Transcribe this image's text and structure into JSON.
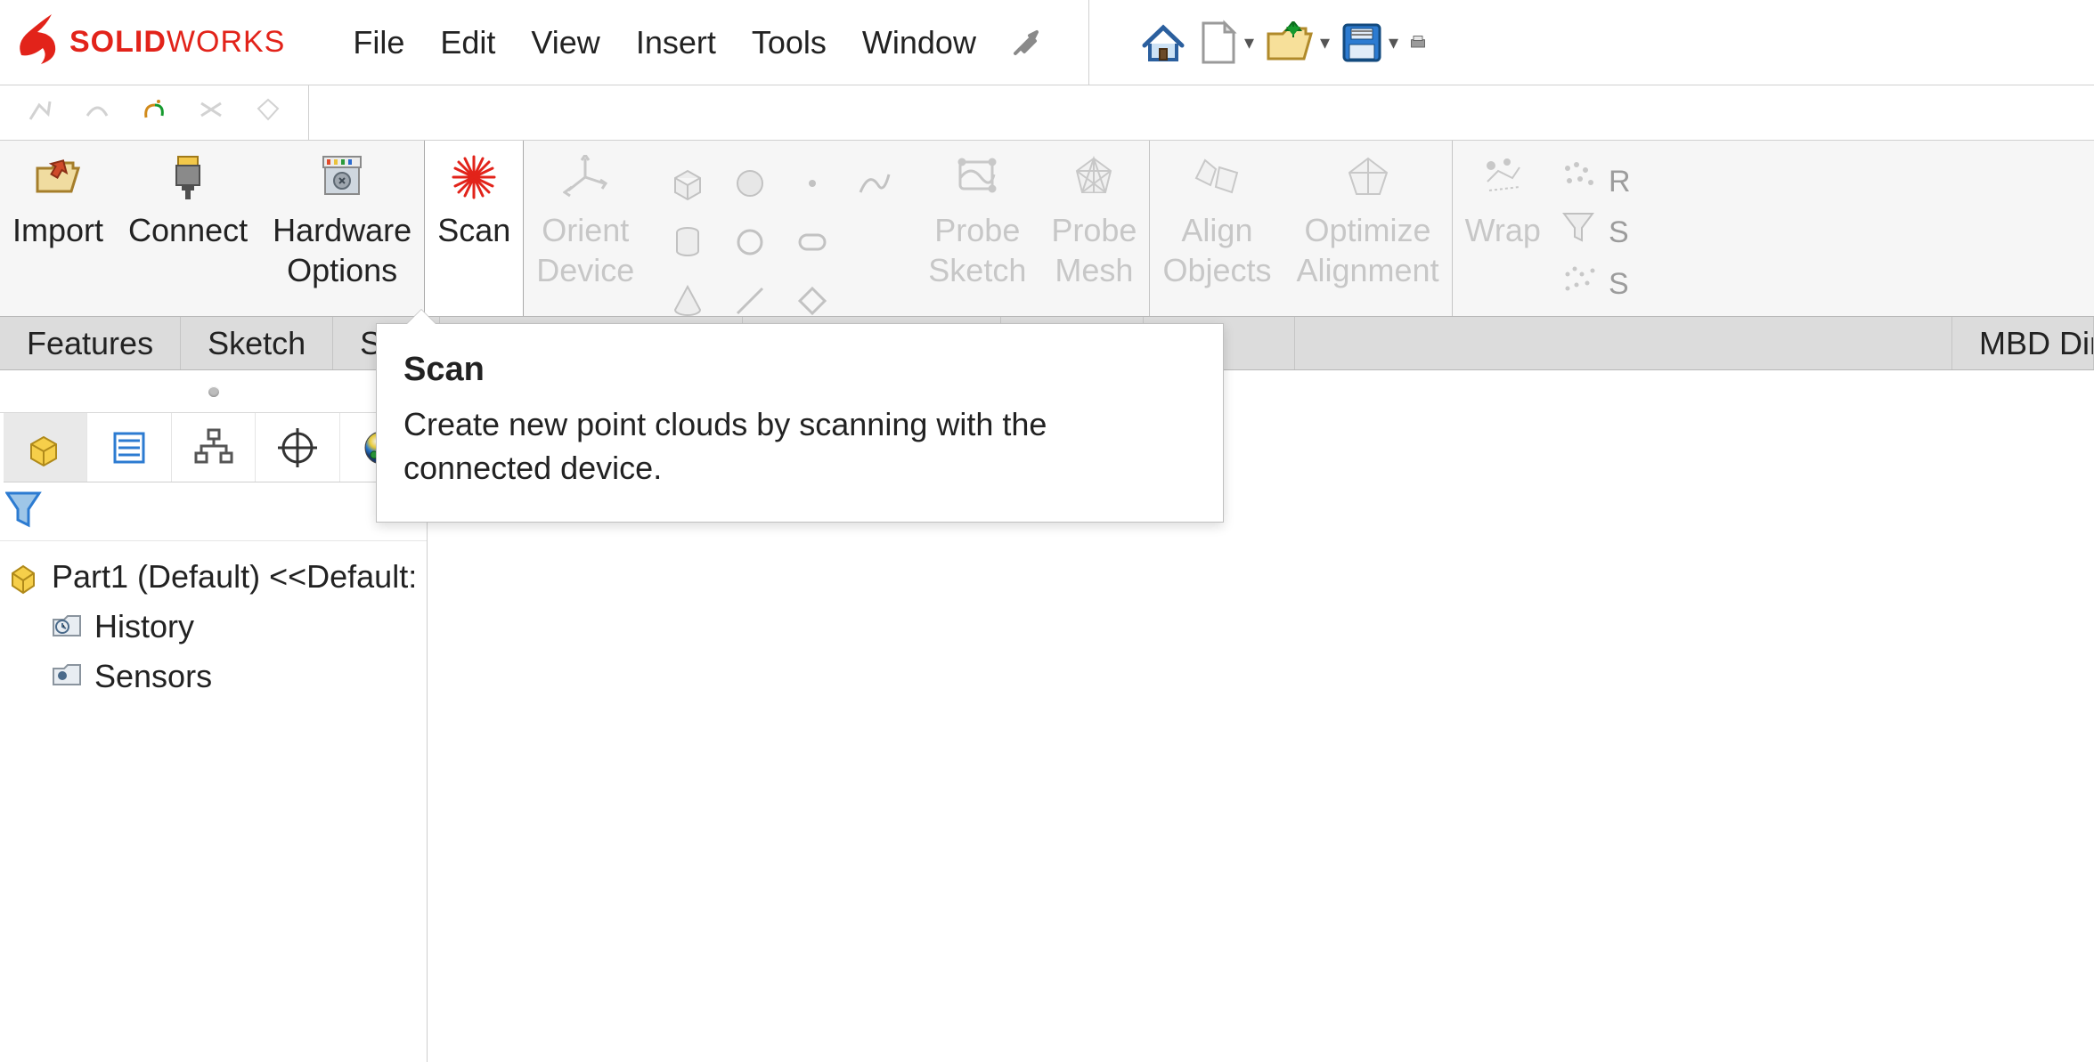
{
  "app": {
    "logo_brand_bold": "SOLID",
    "logo_brand_thin": "WORKS"
  },
  "menus": [
    "File",
    "Edit",
    "View",
    "Insert",
    "Tools",
    "Window"
  ],
  "ribbon": {
    "import": "Import",
    "connect": "Connect",
    "hardware_options": "Hardware\nOptions",
    "scan": "Scan",
    "orient_device": "Orient\nDevice",
    "probe_sketch": "Probe\nSketch",
    "probe_mesh": "Probe\nMesh",
    "align_objects": "Align\nObjects",
    "optimize_alignment": "Optimize\nAlignment",
    "wrap": "Wrap",
    "r_label": "R",
    "s_label1": "S",
    "s_label2": "S"
  },
  "tabs": [
    "Features",
    "Sketch",
    "Surfac",
    "MBD Dir"
  ],
  "tree": {
    "root": "Part1 (Default) <<Default:",
    "history": "History",
    "sensors": "Sensors"
  },
  "tooltip": {
    "title": "Scan",
    "body": "Create new point clouds by scanning with the connected device."
  }
}
